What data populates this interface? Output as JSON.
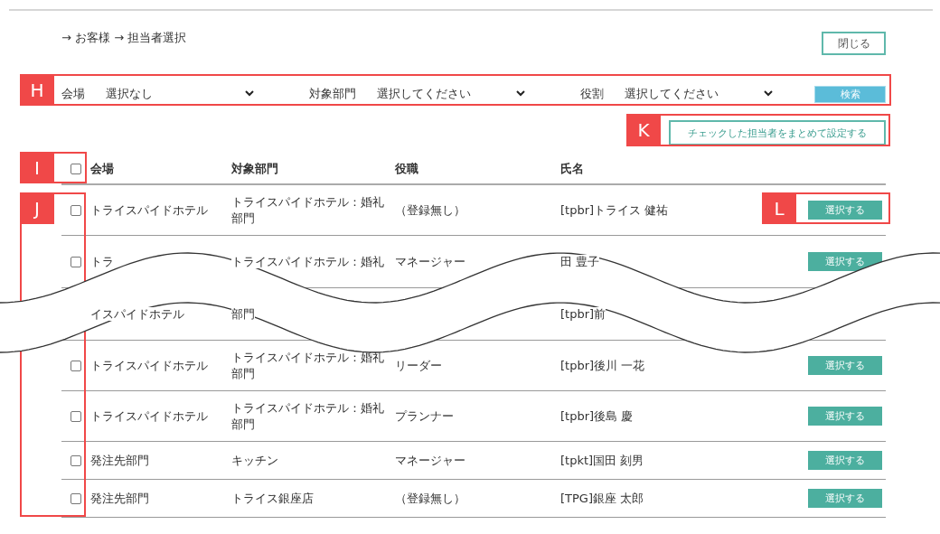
{
  "breadcrumb": "→ お客様 → 担当者選択",
  "close_button": "閉じる",
  "filters": [
    {
      "label": "会場",
      "value": "選択なし"
    },
    {
      "label": "対象部門",
      "value": "選択してください"
    },
    {
      "label": "役割",
      "value": "選択してください"
    }
  ],
  "search_button": "検索",
  "bulk_button": "チェックした担当者をまとめて設定する",
  "table": {
    "select_all_checked": false,
    "columns": [
      "会場",
      "対象部門",
      "役職",
      "氏名"
    ],
    "rows": [
      {
        "kind": "whole",
        "checked": false,
        "venue": "トライスパイドホテル",
        "department": "トライスパイドホテル：婚礼部門",
        "role": "（登録無し）",
        "name": "[tpbr]トライス 健祐",
        "button": "選択する"
      },
      {
        "kind": "cut",
        "checked": false,
        "venue": "トラ",
        "department": "トライスパイドホテル：婚礼",
        "role": "マネージャー",
        "name": "田 豊子",
        "button": "選択する"
      },
      {
        "kind": "cut",
        "venue": "イスパイドホテル",
        "department": "部門",
        "name": "[tpbr]前"
      },
      {
        "kind": "whole",
        "checked": false,
        "venue": "トライスパイドホテル",
        "department": "トライスパイドホテル：婚礼部門",
        "role": "リーダー",
        "name": "[tpbr]後川 一花",
        "button": "選択する"
      },
      {
        "kind": "whole",
        "checked": false,
        "venue": "トライスパイドホテル",
        "department": "トライスパイドホテル：婚礼部門",
        "role": "プランナー",
        "name": "[tpbr]後島 慶",
        "button": "選択する"
      },
      {
        "kind": "whole",
        "checked": false,
        "venue": "発注先部門",
        "department": "キッチン",
        "role": "マネージャー",
        "name": "[tpkt]国田 刻男",
        "button": "選択する"
      },
      {
        "kind": "whole",
        "checked": false,
        "venue": "発注先部門",
        "department": "トライス銀座店",
        "role": "（登録無し）",
        "name": "[TPG]銀座 太郎",
        "button": "選択する"
      }
    ]
  },
  "annotations": [
    {
      "label": "H"
    },
    {
      "label": "I"
    },
    {
      "label": "J"
    },
    {
      "label": "K"
    },
    {
      "label": "L"
    }
  ]
}
